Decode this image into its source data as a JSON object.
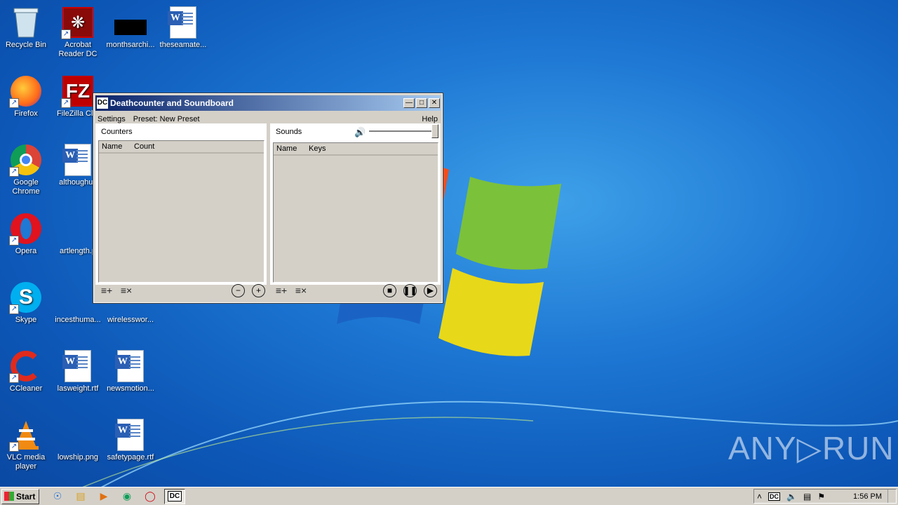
{
  "desktop": {
    "icons": [
      {
        "label": "Recycle Bin"
      },
      {
        "label": "Acrobat Reader DC"
      },
      {
        "label": "monthsarchi..."
      },
      {
        "label": "theseamate..."
      },
      {
        "label": "Firefox"
      },
      {
        "label": "FileZilla Clie"
      },
      {
        "label": "Google Chrome"
      },
      {
        "label": "althoughus"
      },
      {
        "label": "Opera"
      },
      {
        "label": "artlength.p"
      },
      {
        "label": "Skype"
      },
      {
        "label": "incesthuma..."
      },
      {
        "label": "wirelesswor..."
      },
      {
        "label": "CCleaner"
      },
      {
        "label": "lasweight.rtf"
      },
      {
        "label": "newsmotion..."
      },
      {
        "label": "VLC media player"
      },
      {
        "label": "lowship.png"
      },
      {
        "label": "safetypage.rtf"
      }
    ]
  },
  "window": {
    "title": "Deathcounter and Soundboard",
    "icon_text": "DC",
    "menu": {
      "settings": "Settings",
      "preset": "Preset: New Preset",
      "help": "Help"
    },
    "counters": {
      "title": "Counters",
      "col_name": "Name",
      "col_count": "Count"
    },
    "sounds": {
      "title": "Sounds",
      "col_name": "Name",
      "col_keys": "Keys",
      "volume": 1.0
    }
  },
  "watermark": "ANY▷RUN",
  "taskbar": {
    "start": "Start",
    "active_item": "DC",
    "clock": "1:56 PM"
  }
}
